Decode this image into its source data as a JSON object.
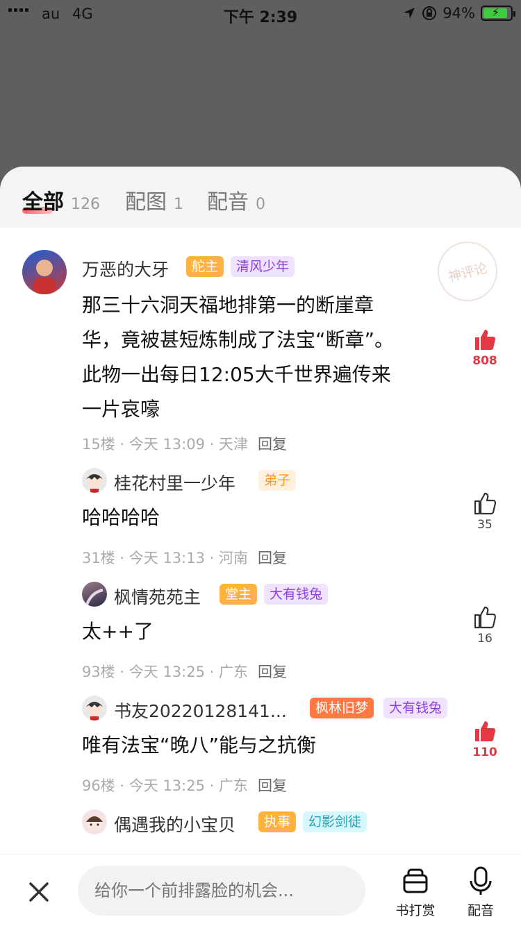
{
  "status": {
    "carrier": "au",
    "network": "4G",
    "time": "下午 2:39",
    "battery": "94%"
  },
  "tabs": [
    {
      "label": "全部",
      "count": "126"
    },
    {
      "label": "配图",
      "count": "1"
    },
    {
      "label": "配音",
      "count": "0"
    }
  ],
  "watermark": "神评论",
  "comments": [
    {
      "user": "万恶的大牙",
      "badges": [
        "舵主",
        "清风少年"
      ],
      "text_lines": [
        "那三十六洞天福地排第一的断崖章",
        "华，竟被甚短炼制成了法宝“断章”。",
        "此物一出每日12:05大千世界遍传来",
        "一片哀嚎"
      ],
      "floor": "15楼",
      "time": "今天 13:09",
      "location": "天津",
      "reply": "回复",
      "likes": "808"
    },
    {
      "user": "桂花村里一少年",
      "badges": [
        "弟子"
      ],
      "text_lines": [
        "哈哈哈哈"
      ],
      "floor": "31楼",
      "time": "今天 13:13",
      "location": "河南",
      "reply": "回复",
      "likes": "35"
    },
    {
      "user": "枫情苑苑主",
      "badges": [
        "堂主",
        "大有钱兔"
      ],
      "text_lines": [
        "太++了"
      ],
      "floor": "93楼",
      "time": "今天 13:25",
      "location": "广东",
      "reply": "回复",
      "likes": "16"
    },
    {
      "user": "书友20220128141...",
      "badges": [
        "枫林旧梦",
        "大有钱兔"
      ],
      "text_lines": [
        "唯有法宝“晚八”能与之抗衡"
      ],
      "floor": "96楼",
      "time": "今天 13:25",
      "location": "广东",
      "reply": "回复",
      "likes": "110"
    },
    {
      "user": "偶遇我的小宝贝",
      "badges": [
        "执事",
        "幻影剑徒"
      ]
    }
  ],
  "bottom": {
    "input_placeholder": "给你一个前排露脸的机会...",
    "reward_label": "书打赏",
    "voice_label": "配音"
  },
  "colors": {
    "like_hot": "#e23a45",
    "accent": "#ff4a57"
  }
}
